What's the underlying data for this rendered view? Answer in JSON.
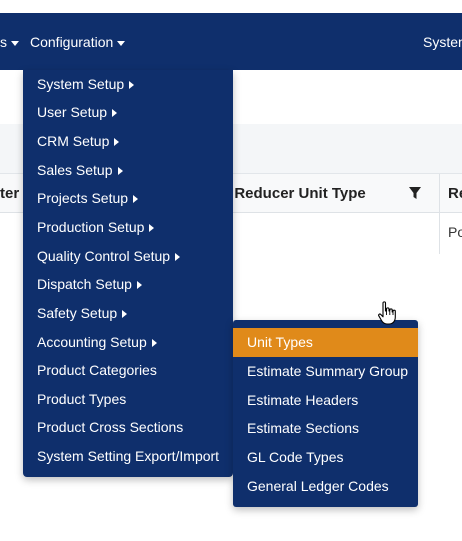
{
  "navbar": {
    "left_partial": "s",
    "configuration_label": "Configuration",
    "right_partial": "System"
  },
  "table": {
    "header_left_partial": "ter",
    "header_middle": "er Reducer Unit Type",
    "header_right_partial": "Re",
    "cell_right_partial": "Po"
  },
  "config_menu": {
    "items": [
      {
        "label": "System Setup",
        "has_submenu": true
      },
      {
        "label": "User Setup",
        "has_submenu": true
      },
      {
        "label": "CRM Setup",
        "has_submenu": true
      },
      {
        "label": "Sales Setup",
        "has_submenu": true
      },
      {
        "label": "Projects Setup",
        "has_submenu": true
      },
      {
        "label": "Production Setup",
        "has_submenu": true
      },
      {
        "label": "Quality Control Setup",
        "has_submenu": true
      },
      {
        "label": "Dispatch Setup",
        "has_submenu": true
      },
      {
        "label": "Safety Setup",
        "has_submenu": true
      },
      {
        "label": "Accounting Setup",
        "has_submenu": true
      },
      {
        "label": "Product Categories",
        "has_submenu": false
      },
      {
        "label": "Product Types",
        "has_submenu": false
      },
      {
        "label": "Product Cross Sections",
        "has_submenu": false
      },
      {
        "label": "System Setting Export/Import",
        "has_submenu": false
      }
    ]
  },
  "accounting_submenu": {
    "items": [
      {
        "label": "Unit Types",
        "active": true
      },
      {
        "label": "Estimate Summary Group",
        "active": false
      },
      {
        "label": "Estimate Headers",
        "active": false
      },
      {
        "label": "Estimate Sections",
        "active": false
      },
      {
        "label": "GL Code Types",
        "active": false
      },
      {
        "label": "General Ledger Codes",
        "active": false
      }
    ]
  },
  "colors": {
    "navbar_bg": "#0f2f6c",
    "active_item_bg": "#e08a1a"
  },
  "icons": [
    "caret-down-icon",
    "caret-right-icon",
    "filter-icon",
    "hand-cursor-icon"
  ]
}
